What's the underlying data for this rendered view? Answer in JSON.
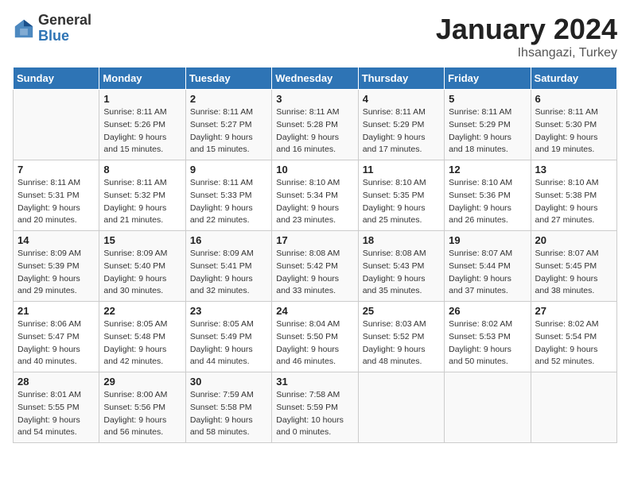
{
  "header": {
    "logo_general": "General",
    "logo_blue": "Blue",
    "title": "January 2024",
    "location": "Ihsangazi, Turkey"
  },
  "weekdays": [
    "Sunday",
    "Monday",
    "Tuesday",
    "Wednesday",
    "Thursday",
    "Friday",
    "Saturday"
  ],
  "weeks": [
    [
      {
        "day": "",
        "sunrise": "",
        "sunset": "",
        "daylight": ""
      },
      {
        "day": "1",
        "sunrise": "Sunrise: 8:11 AM",
        "sunset": "Sunset: 5:26 PM",
        "daylight": "Daylight: 9 hours and 15 minutes."
      },
      {
        "day": "2",
        "sunrise": "Sunrise: 8:11 AM",
        "sunset": "Sunset: 5:27 PM",
        "daylight": "Daylight: 9 hours and 15 minutes."
      },
      {
        "day": "3",
        "sunrise": "Sunrise: 8:11 AM",
        "sunset": "Sunset: 5:28 PM",
        "daylight": "Daylight: 9 hours and 16 minutes."
      },
      {
        "day": "4",
        "sunrise": "Sunrise: 8:11 AM",
        "sunset": "Sunset: 5:29 PM",
        "daylight": "Daylight: 9 hours and 17 minutes."
      },
      {
        "day": "5",
        "sunrise": "Sunrise: 8:11 AM",
        "sunset": "Sunset: 5:29 PM",
        "daylight": "Daylight: 9 hours and 18 minutes."
      },
      {
        "day": "6",
        "sunrise": "Sunrise: 8:11 AM",
        "sunset": "Sunset: 5:30 PM",
        "daylight": "Daylight: 9 hours and 19 minutes."
      }
    ],
    [
      {
        "day": "7",
        "sunrise": "Sunrise: 8:11 AM",
        "sunset": "Sunset: 5:31 PM",
        "daylight": "Daylight: 9 hours and 20 minutes."
      },
      {
        "day": "8",
        "sunrise": "Sunrise: 8:11 AM",
        "sunset": "Sunset: 5:32 PM",
        "daylight": "Daylight: 9 hours and 21 minutes."
      },
      {
        "day": "9",
        "sunrise": "Sunrise: 8:11 AM",
        "sunset": "Sunset: 5:33 PM",
        "daylight": "Daylight: 9 hours and 22 minutes."
      },
      {
        "day": "10",
        "sunrise": "Sunrise: 8:10 AM",
        "sunset": "Sunset: 5:34 PM",
        "daylight": "Daylight: 9 hours and 23 minutes."
      },
      {
        "day": "11",
        "sunrise": "Sunrise: 8:10 AM",
        "sunset": "Sunset: 5:35 PM",
        "daylight": "Daylight: 9 hours and 25 minutes."
      },
      {
        "day": "12",
        "sunrise": "Sunrise: 8:10 AM",
        "sunset": "Sunset: 5:36 PM",
        "daylight": "Daylight: 9 hours and 26 minutes."
      },
      {
        "day": "13",
        "sunrise": "Sunrise: 8:10 AM",
        "sunset": "Sunset: 5:38 PM",
        "daylight": "Daylight: 9 hours and 27 minutes."
      }
    ],
    [
      {
        "day": "14",
        "sunrise": "Sunrise: 8:09 AM",
        "sunset": "Sunset: 5:39 PM",
        "daylight": "Daylight: 9 hours and 29 minutes."
      },
      {
        "day": "15",
        "sunrise": "Sunrise: 8:09 AM",
        "sunset": "Sunset: 5:40 PM",
        "daylight": "Daylight: 9 hours and 30 minutes."
      },
      {
        "day": "16",
        "sunrise": "Sunrise: 8:09 AM",
        "sunset": "Sunset: 5:41 PM",
        "daylight": "Daylight: 9 hours and 32 minutes."
      },
      {
        "day": "17",
        "sunrise": "Sunrise: 8:08 AM",
        "sunset": "Sunset: 5:42 PM",
        "daylight": "Daylight: 9 hours and 33 minutes."
      },
      {
        "day": "18",
        "sunrise": "Sunrise: 8:08 AM",
        "sunset": "Sunset: 5:43 PM",
        "daylight": "Daylight: 9 hours and 35 minutes."
      },
      {
        "day": "19",
        "sunrise": "Sunrise: 8:07 AM",
        "sunset": "Sunset: 5:44 PM",
        "daylight": "Daylight: 9 hours and 37 minutes."
      },
      {
        "day": "20",
        "sunrise": "Sunrise: 8:07 AM",
        "sunset": "Sunset: 5:45 PM",
        "daylight": "Daylight: 9 hours and 38 minutes."
      }
    ],
    [
      {
        "day": "21",
        "sunrise": "Sunrise: 8:06 AM",
        "sunset": "Sunset: 5:47 PM",
        "daylight": "Daylight: 9 hours and 40 minutes."
      },
      {
        "day": "22",
        "sunrise": "Sunrise: 8:05 AM",
        "sunset": "Sunset: 5:48 PM",
        "daylight": "Daylight: 9 hours and 42 minutes."
      },
      {
        "day": "23",
        "sunrise": "Sunrise: 8:05 AM",
        "sunset": "Sunset: 5:49 PM",
        "daylight": "Daylight: 9 hours and 44 minutes."
      },
      {
        "day": "24",
        "sunrise": "Sunrise: 8:04 AM",
        "sunset": "Sunset: 5:50 PM",
        "daylight": "Daylight: 9 hours and 46 minutes."
      },
      {
        "day": "25",
        "sunrise": "Sunrise: 8:03 AM",
        "sunset": "Sunset: 5:52 PM",
        "daylight": "Daylight: 9 hours and 48 minutes."
      },
      {
        "day": "26",
        "sunrise": "Sunrise: 8:02 AM",
        "sunset": "Sunset: 5:53 PM",
        "daylight": "Daylight: 9 hours and 50 minutes."
      },
      {
        "day": "27",
        "sunrise": "Sunrise: 8:02 AM",
        "sunset": "Sunset: 5:54 PM",
        "daylight": "Daylight: 9 hours and 52 minutes."
      }
    ],
    [
      {
        "day": "28",
        "sunrise": "Sunrise: 8:01 AM",
        "sunset": "Sunset: 5:55 PM",
        "daylight": "Daylight: 9 hours and 54 minutes."
      },
      {
        "day": "29",
        "sunrise": "Sunrise: 8:00 AM",
        "sunset": "Sunset: 5:56 PM",
        "daylight": "Daylight: 9 hours and 56 minutes."
      },
      {
        "day": "30",
        "sunrise": "Sunrise: 7:59 AM",
        "sunset": "Sunset: 5:58 PM",
        "daylight": "Daylight: 9 hours and 58 minutes."
      },
      {
        "day": "31",
        "sunrise": "Sunrise: 7:58 AM",
        "sunset": "Sunset: 5:59 PM",
        "daylight": "Daylight: 10 hours and 0 minutes."
      },
      {
        "day": "",
        "sunrise": "",
        "sunset": "",
        "daylight": ""
      },
      {
        "day": "",
        "sunrise": "",
        "sunset": "",
        "daylight": ""
      },
      {
        "day": "",
        "sunrise": "",
        "sunset": "",
        "daylight": ""
      }
    ]
  ]
}
